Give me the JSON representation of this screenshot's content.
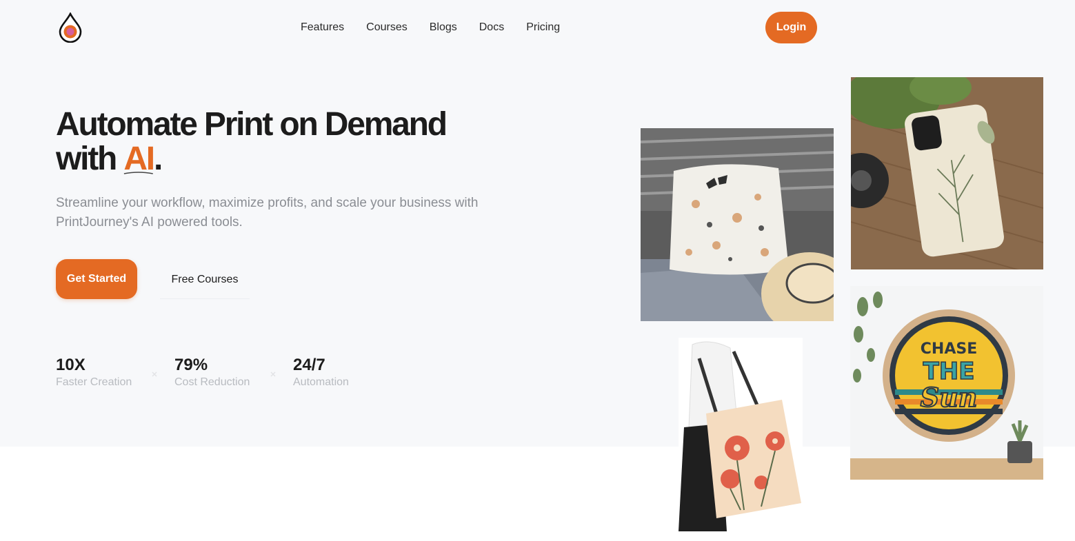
{
  "brand": {
    "accent_color": "#e46a23",
    "logo_icon": "droplet-logo-icon"
  },
  "nav": {
    "items": [
      "Features",
      "Courses",
      "Blogs",
      "Docs",
      "Pricing"
    ],
    "login_label": "Login"
  },
  "hero": {
    "headline_line1": "Automate Print on Demand",
    "headline_line2_prefix": "with ",
    "headline_highlight": "AI",
    "headline_suffix": ".",
    "subheadline": "Streamline your workflow, maximize profits, and scale your business with PrintJourney's AI powered tools.",
    "primary_cta": "Get Started",
    "secondary_cta": "Free Courses"
  },
  "stats": [
    {
      "value": "10X",
      "label": "Faster Creation"
    },
    {
      "value": "79%",
      "label": "Cost Reduction"
    },
    {
      "value": "24/7",
      "label": "Automation"
    }
  ],
  "gallery": {
    "items": [
      "butterfly-pillow-image",
      "botanical-phone-case-image",
      "chase-the-sun-clock-image",
      "floral-tote-bag-image"
    ],
    "clock_text_1": "CHASE",
    "clock_text_2": "THE",
    "clock_text_3": "Sun"
  }
}
